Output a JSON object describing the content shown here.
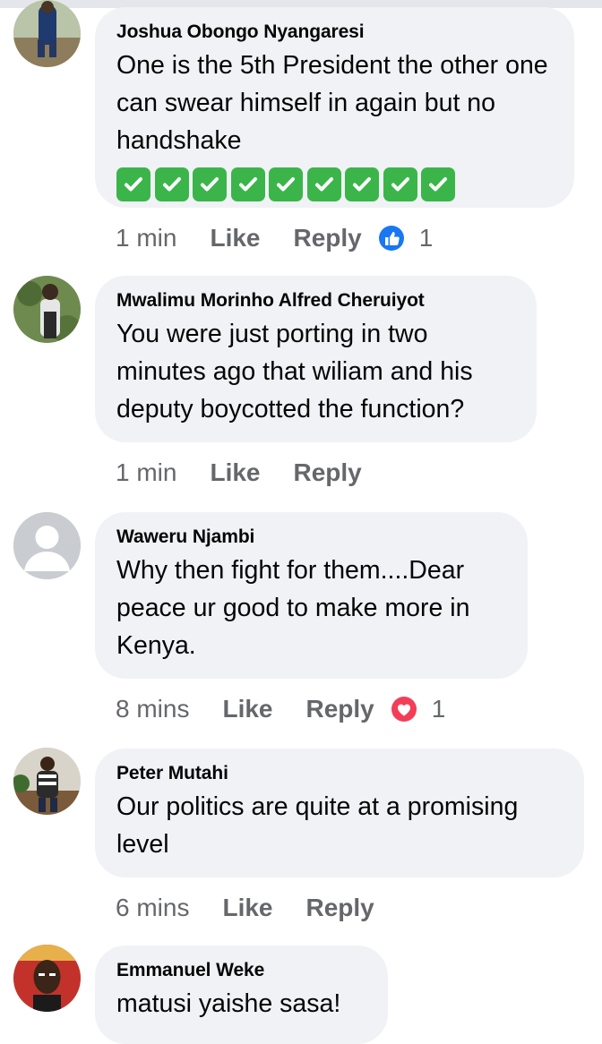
{
  "comments": [
    {
      "author": "Joshua Obongo Nyangaresi",
      "text": "One is the 5th President the other one can swear himself in again but no handshake",
      "emoji_row": "✅✅✅✅✅✅✅✅✅",
      "time": "1 min",
      "like_label": "Like",
      "reply_label": "Reply",
      "reaction": {
        "icon": "like-reaction-icon",
        "count": "1",
        "color": "#1877f2"
      }
    },
    {
      "author": "Mwalimu Morinho Alfred Cheruiyot",
      "text": "You were just porting in two minutes ago that wiliam and his deputy boycotted the function?",
      "time": "1 min",
      "like_label": "Like",
      "reply_label": "Reply"
    },
    {
      "author": "Waweru Njambi",
      "text": "Why then fight for them....Dear peace ur good to make more in Kenya.",
      "time": "8 mins",
      "like_label": "Like",
      "reply_label": "Reply",
      "reaction": {
        "icon": "love-reaction-icon",
        "count": "1",
        "color": "#f33e58"
      }
    },
    {
      "author": "Peter Mutahi",
      "text": "Our politics are quite at a promising level",
      "time": "6 mins",
      "like_label": "Like",
      "reply_label": "Reply"
    },
    {
      "author": "Emmanuel Weke",
      "text": "matusi yaishe sasa!"
    }
  ],
  "colors": {
    "bubble": "#f0f2f5",
    "meta_text": "#65676b",
    "check_green": "#3bb54a"
  }
}
